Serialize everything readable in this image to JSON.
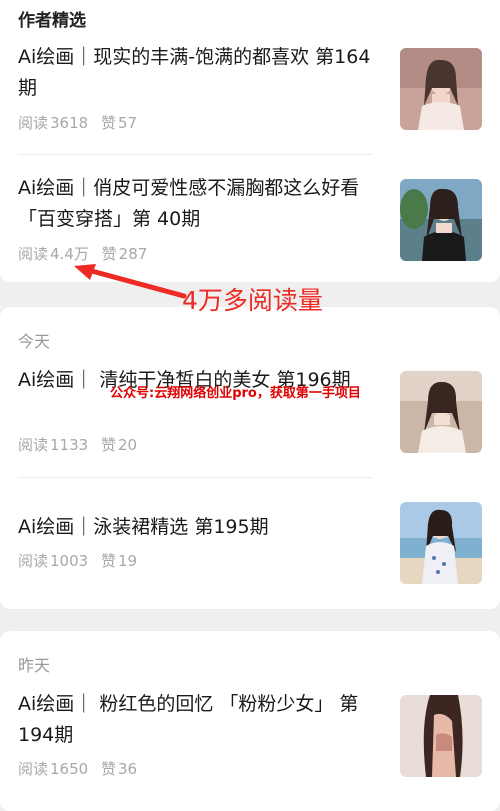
{
  "sections": {
    "featured": {
      "title": "作者精选",
      "articles": [
        {
          "title": "Ai绘画｜现实的丰满-饱满的都喜欢 第164期",
          "read_label": "阅读",
          "read_count": "3618",
          "like_label": "赞",
          "like_count": "57",
          "thumb_icon": "portrait-photo"
        },
        {
          "title": "Ai绘画｜俏皮可爱性感不漏胸都这么好看 「百变穿搭」第 40期",
          "read_label": "阅读",
          "read_count": "4.4万",
          "like_label": "赞",
          "like_count": "287",
          "thumb_icon": "portrait-photo"
        }
      ]
    },
    "today": {
      "title": "今天",
      "articles": [
        {
          "title": "Ai绘画｜ 清纯干净皙白的美女 第196期",
          "read_label": "阅读",
          "read_count": "1133",
          "like_label": "赞",
          "like_count": "20",
          "thumb_icon": "portrait-photo"
        },
        {
          "title": "Ai绘画｜泳装裙精选 第195期",
          "read_label": "阅读",
          "read_count": "1003",
          "like_label": "赞",
          "like_count": "19",
          "thumb_icon": "portrait-photo"
        }
      ]
    },
    "yesterday": {
      "title": "昨天",
      "articles": [
        {
          "title": "Ai绘画｜ 粉红色的回忆 「粉粉少女」 第194期",
          "read_label": "阅读",
          "read_count": "1650",
          "like_label": "赞",
          "like_count": "36",
          "thumb_icon": "portrait-photo"
        }
      ]
    }
  },
  "annotation": {
    "text": "4万多阅读量",
    "color": "#ee2a24"
  },
  "watermark": {
    "text": "公众号:云翔网络创业pro，获取第一手项目",
    "color": "#e00000"
  }
}
